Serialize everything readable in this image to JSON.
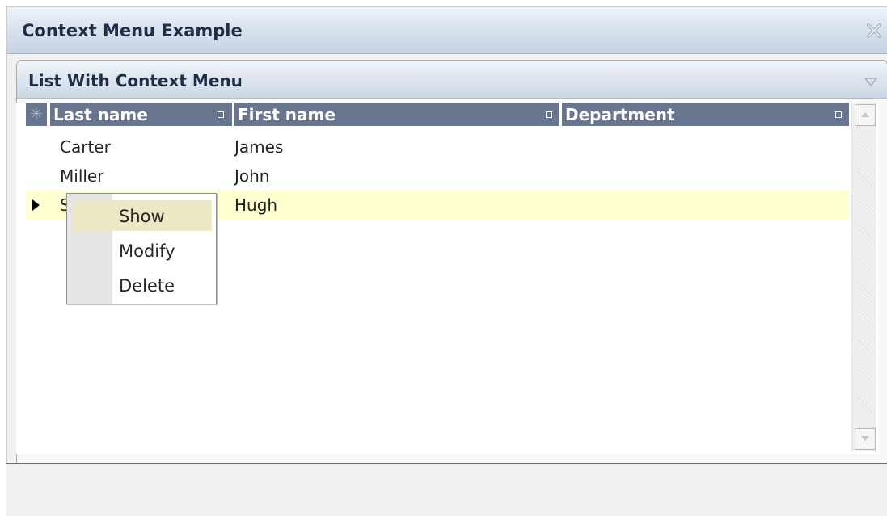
{
  "window": {
    "title": "Context Menu Example"
  },
  "panel": {
    "title": "List With Context Menu"
  },
  "grid": {
    "columns": [
      {
        "label": "Last name"
      },
      {
        "label": "First name"
      },
      {
        "label": "Department"
      }
    ],
    "rows": [
      {
        "last_name": "Carter",
        "first_name": "James",
        "department": ""
      },
      {
        "last_name": "Miller",
        "first_name": "John",
        "department": ""
      },
      {
        "last_name": "S",
        "first_name": "Hugh",
        "department": ""
      }
    ],
    "selected_row": 3
  },
  "context_menu": {
    "items": [
      {
        "label": "Show",
        "highlighted": true
      },
      {
        "label": "Modify",
        "highlighted": false
      },
      {
        "label": "Delete",
        "highlighted": false
      }
    ]
  },
  "colors": {
    "header_bg": "#67758f",
    "selected_row_bg": "#ffffd0",
    "menu_highlight_bg": "#ede8c4"
  },
  "icons": {
    "close": "close-x-icon",
    "collapse": "triangle-down-icon",
    "scroll_up": "arrow-up-icon",
    "scroll_down": "arrow-down-icon",
    "row_marker": "triangle-right-icon",
    "header_corner": "asterisk-icon"
  }
}
